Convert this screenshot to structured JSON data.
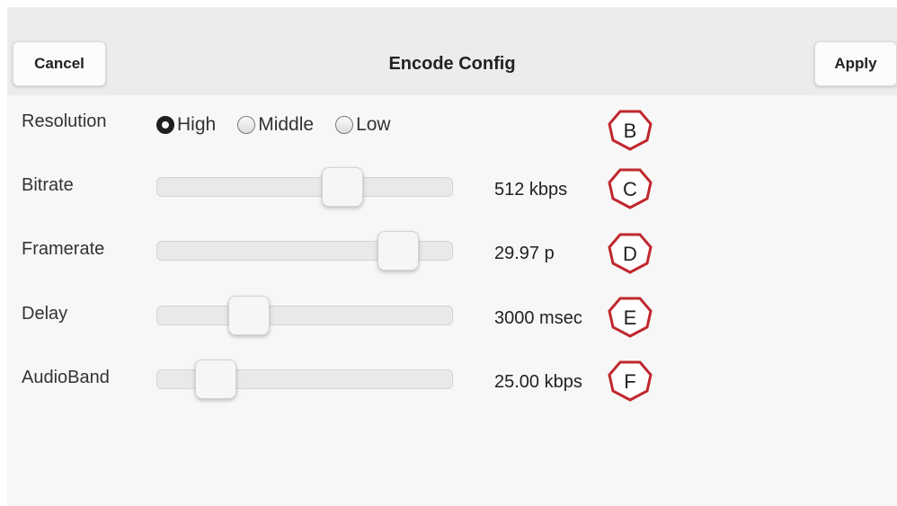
{
  "navbar": {
    "cancel_label": "Cancel",
    "title": "Encode Config",
    "apply_label": "Apply"
  },
  "resolution": {
    "label": "Resolution",
    "options": [
      {
        "label": "High",
        "selected": true
      },
      {
        "label": "Middle",
        "selected": false
      },
      {
        "label": "Low",
        "selected": false
      }
    ],
    "marker": "B"
  },
  "bitrate": {
    "label": "Bitrate",
    "value_text": "512 kbps",
    "level": 0.65,
    "marker": "C"
  },
  "framerate": {
    "label": "Framerate",
    "value_text": "29.97 p",
    "level": 0.87,
    "marker": "D"
  },
  "delay": {
    "label": "Delay",
    "value_text": "3000 msec",
    "level": 0.28,
    "marker": "E"
  },
  "audioband": {
    "label": "AudioBand",
    "value_text": "25.00 kbps",
    "level": 0.15,
    "marker": "F"
  },
  "colors": {
    "marker_stroke": "#c0282e",
    "navbar_bg": "#ececec",
    "panel_bg": "#f7f7f7"
  }
}
